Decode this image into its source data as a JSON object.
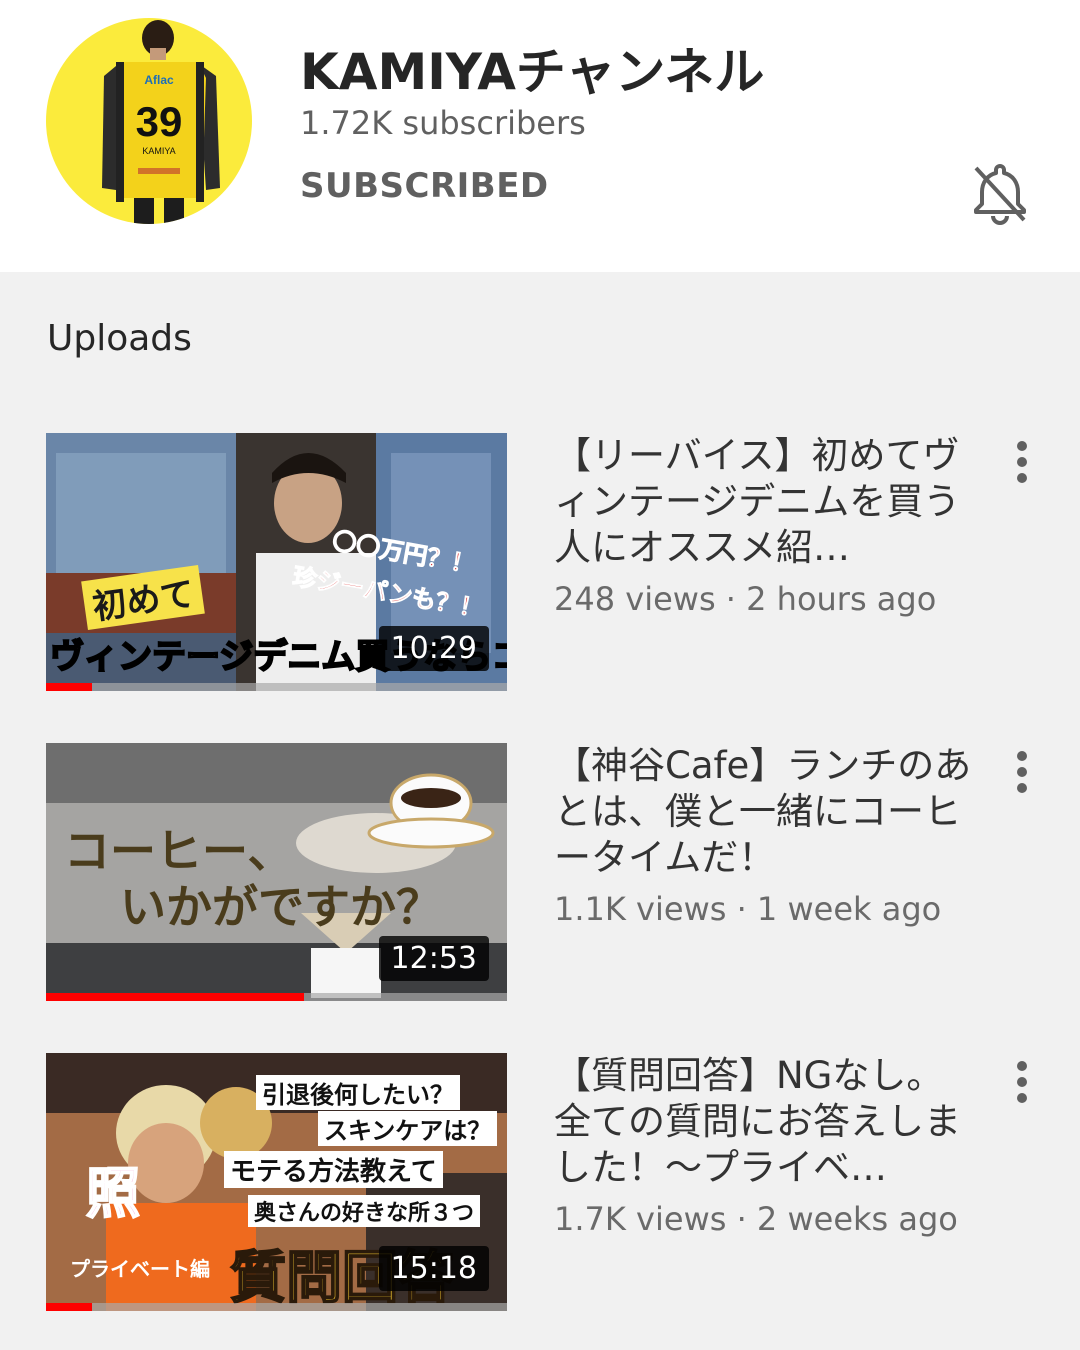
{
  "channel": {
    "name": "KAMIYAチャンネル",
    "subscribers": "1.72K subscribers",
    "subscribe_state": "SUBSCRIBED",
    "avatar_jersey_number": "39",
    "avatar_jersey_sponsor": "Aflac",
    "avatar_jersey_name": "KAMIYA",
    "notification_icon": "bell-off-icon",
    "avatar_bg_color": "#fbeb3c"
  },
  "section": {
    "title": "Uploads"
  },
  "videos": [
    {
      "title": "【リーバイス】初めてヴィンテージデニムを買う人にオススメ紹…",
      "meta": "248 views · 2 hours ago",
      "duration": "10:29",
      "watched_fraction": 0.1,
      "thumb_text": {
        "a": "初めて",
        "b": "ヴィンテージデニム買うならコレ！",
        "c": "〇〇万円？！",
        "d": "珍ジーパンも？！"
      }
    },
    {
      "title": "【神谷Cafe】ランチのあとは、僕と一緒にコーヒータイムだ！",
      "meta": "1.1K views · 1 week ago",
      "duration": "12:53",
      "watched_fraction": 0.56,
      "thumb_text": {
        "a": "コーヒー、",
        "b": "いかがですか？"
      }
    },
    {
      "title": "【質問回答】NGなし。全ての質問にお答えしました！〜プライベ…",
      "meta": "1.7K views · 2 weeks ago",
      "duration": "15:18",
      "watched_fraction": 0.1,
      "thumb_text": {
        "a": "引退後何したい？",
        "b": "スキンケアは？",
        "c": "モテる方法教えて",
        "d": "奥さんの好きな所３つ",
        "e": "照",
        "f": "プライベート編",
        "g": "質問回答"
      }
    }
  ],
  "colors": {
    "accent": "#ff0000",
    "background": "#f1f1f1",
    "header": "#ffffff"
  }
}
